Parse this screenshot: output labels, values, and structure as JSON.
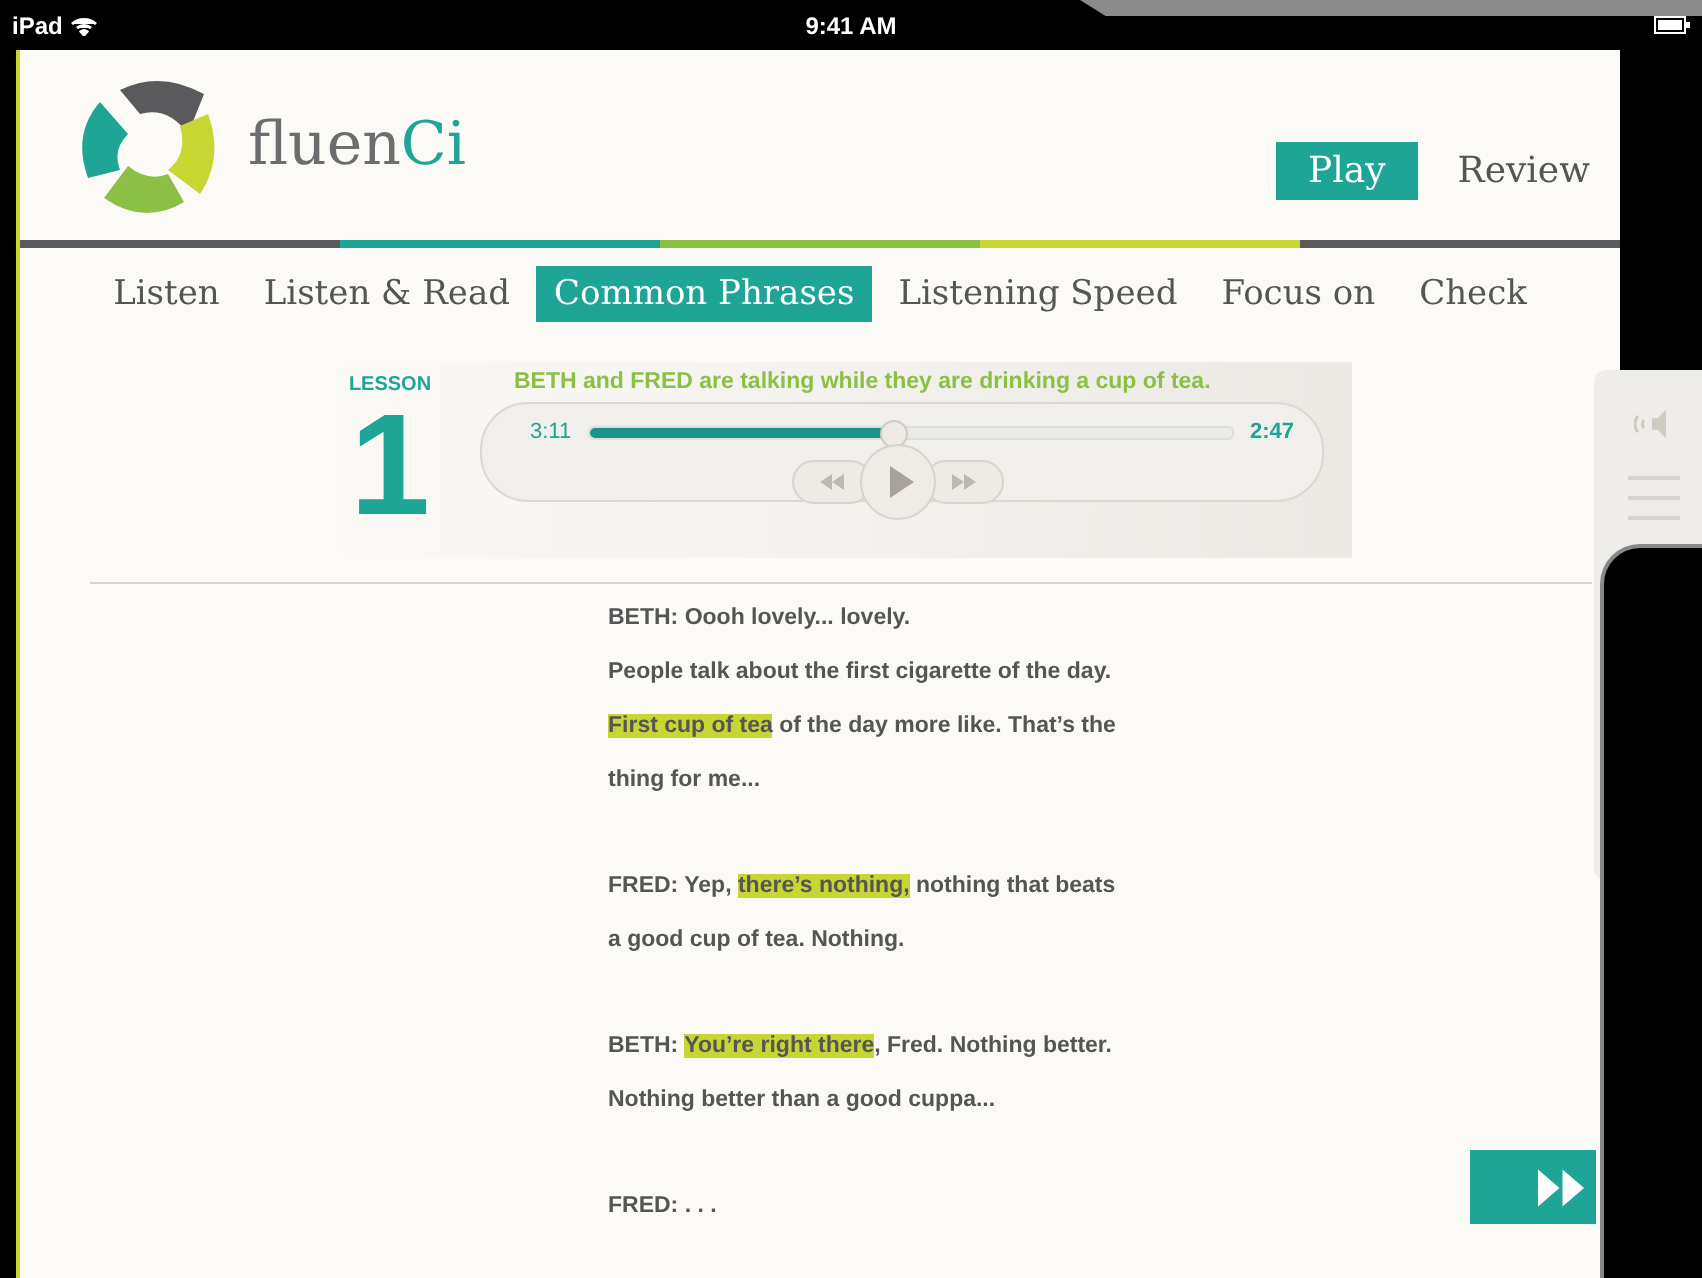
{
  "status_bar": {
    "carrier": "iPad",
    "time": "9:41 AM"
  },
  "logo": {
    "text": "fluen",
    "accent": "Ci"
  },
  "mode_tabs": [
    {
      "label": "Play",
      "selected": true
    },
    {
      "label": "Review",
      "selected": false
    }
  ],
  "nav_tabs": [
    {
      "label": "Listen",
      "selected": false
    },
    {
      "label": "Listen & Read",
      "selected": false
    },
    {
      "label": "Common Phrases",
      "selected": true
    },
    {
      "label": "Listening Speed",
      "selected": false
    },
    {
      "label": "Focus on",
      "selected": false
    },
    {
      "label": "Check",
      "selected": false
    }
  ],
  "lesson": {
    "label": "LESSON",
    "number": "1",
    "description": "BETH and FRED are talking while they are drinking a cup of tea.",
    "elapsed": "3:11",
    "remaining": "2:47",
    "level": 0.47
  },
  "transcript": [
    {
      "lines": [
        [
          {
            "text": "BETH: Oooh lovely... lovely.",
            "highlighted": false
          }
        ],
        [
          {
            "text": "People talk about the first cigarette of the day.",
            "highlighted": false
          }
        ],
        [
          {
            "text": "First cup of tea",
            "highlighted": true
          },
          {
            "text": " of the day more like. That’s the",
            "highlighted": false
          }
        ],
        [
          {
            "text": "thing for me...",
            "highlighted": false
          }
        ]
      ]
    },
    {
      "lines": [
        [
          {
            "text": "FRED: Yep, ",
            "highlighted": false
          },
          {
            "text": "there’s nothing,",
            "highlighted": true
          },
          {
            "text": " nothing that beats",
            "highlighted": false
          }
        ],
        [
          {
            "text": "a good cup of tea. Nothing.",
            "highlighted": false
          }
        ]
      ]
    },
    {
      "lines": [
        [
          {
            "text": "BETH: ",
            "highlighted": false
          },
          {
            "text": "You’re right there",
            "highlighted": true
          },
          {
            "text": ", Fred. Nothing better.",
            "highlighted": false
          }
        ],
        [
          {
            "text": "Nothing better than a good cuppa...",
            "highlighted": false
          }
        ]
      ]
    },
    {
      "lines": [
        [
          {
            "text": "FRED:  . . .",
            "highlighted": false
          }
        ]
      ]
    }
  ]
}
